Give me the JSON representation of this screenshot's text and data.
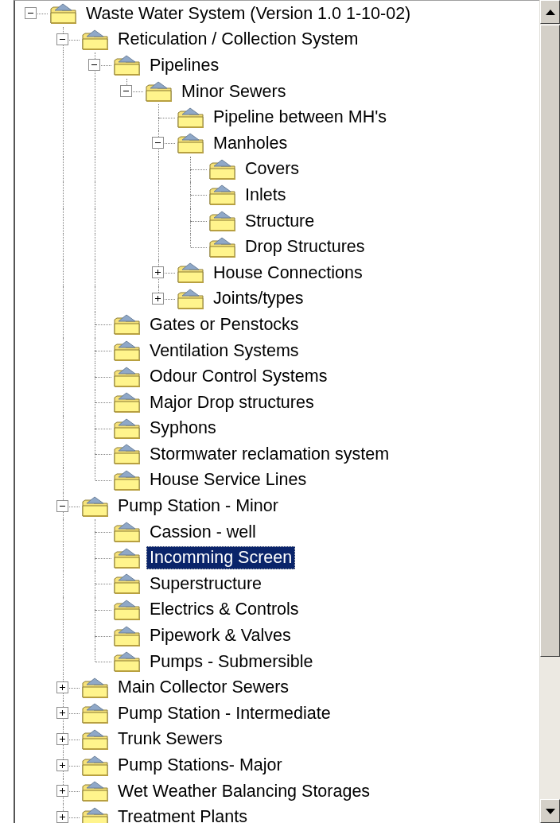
{
  "tree": [
    {
      "label": "Waste Water System (Version 1.0 1-10-02)",
      "expanded": true,
      "selected": false,
      "children": [
        {
          "label": "Reticulation / Collection System",
          "expanded": true,
          "selected": false,
          "children": [
            {
              "label": "Pipelines",
              "expanded": true,
              "selected": false,
              "children": [
                {
                  "label": "Minor Sewers",
                  "expanded": true,
                  "selected": false,
                  "children": [
                    {
                      "label": "Pipeline between MH's",
                      "selected": false
                    },
                    {
                      "label": "Manholes",
                      "expanded": true,
                      "selected": false,
                      "children": [
                        {
                          "label": "Covers",
                          "selected": false
                        },
                        {
                          "label": "Inlets",
                          "selected": false
                        },
                        {
                          "label": "Structure",
                          "selected": false
                        },
                        {
                          "label": "Drop Structures",
                          "selected": false
                        }
                      ]
                    },
                    {
                      "label": "House Connections",
                      "expanded": false,
                      "selected": false
                    },
                    {
                      "label": "Joints/types",
                      "expanded": false,
                      "selected": false
                    }
                  ]
                }
              ]
            },
            {
              "label": "Gates or Penstocks",
              "selected": false
            },
            {
              "label": "Ventilation Systems",
              "selected": false
            },
            {
              "label": "Odour Control Systems",
              "selected": false
            },
            {
              "label": "Major Drop structures",
              "selected": false
            },
            {
              "label": "Syphons",
              "selected": false
            },
            {
              "label": "Stormwater reclamation system",
              "selected": false
            },
            {
              "label": "House Service Lines",
              "selected": false
            }
          ]
        },
        {
          "label": "Pump Station - Minor",
          "expanded": true,
          "selected": false,
          "children": [
            {
              "label": "Cassion - well",
              "selected": false
            },
            {
              "label": "Incomming Screen",
              "selected": true
            },
            {
              "label": "Superstructure",
              "selected": false
            },
            {
              "label": "Electrics & Controls",
              "selected": false
            },
            {
              "label": "Pipework & Valves",
              "selected": false
            },
            {
              "label": "Pumps - Submersible",
              "selected": false
            }
          ]
        },
        {
          "label": "Main Collector Sewers",
          "expanded": false,
          "selected": false
        },
        {
          "label": "Pump Station - Intermediate",
          "expanded": false,
          "selected": false
        },
        {
          "label": "Trunk Sewers",
          "expanded": false,
          "selected": false
        },
        {
          "label": "Pump Stations- Major",
          "expanded": false,
          "selected": false
        },
        {
          "label": "Wet Weather Balancing Storages",
          "expanded": false,
          "selected": false
        },
        {
          "label": "Treatment Plants",
          "expanded": false,
          "selected": false
        }
      ]
    }
  ]
}
